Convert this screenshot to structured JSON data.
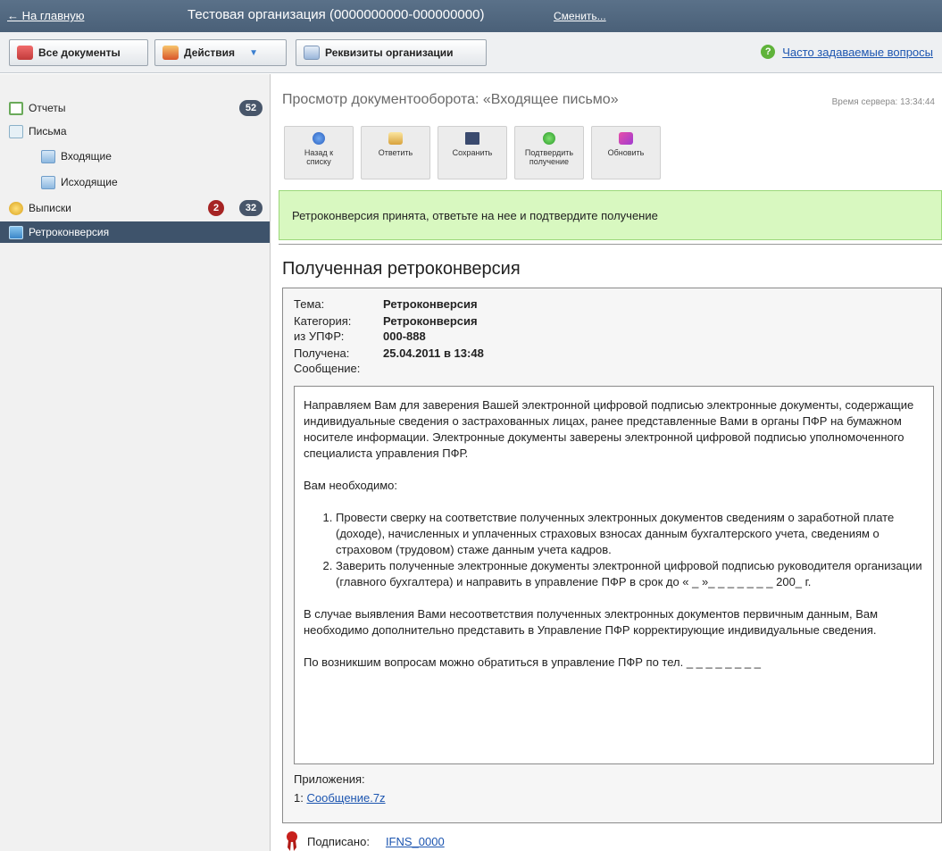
{
  "topbar": {
    "home_link": "← На главную",
    "org_name": "Тестовая организация (0000000000-000000000)",
    "change_link": "Сменить..."
  },
  "toolbar": {
    "all_docs": "Все документы",
    "actions": "Действия",
    "org_details": "Реквизиты организации",
    "faq": "Часто задаваемые вопросы"
  },
  "sidebar": {
    "reports": {
      "label": "Отчеты",
      "count": "52"
    },
    "letters": {
      "label": "Письма"
    },
    "incoming": {
      "label": "Входящие"
    },
    "outgoing": {
      "label": "Исходящие"
    },
    "statements": {
      "label": "Выписки",
      "count_red": "2",
      "count": "32"
    },
    "retro": {
      "label": "Ретроконверсия"
    }
  },
  "content": {
    "title": "Просмотр документооборота: «Входящее письмо»",
    "server_time": "Время сервера: 13:34:44",
    "actions": {
      "back": "Назад к списку",
      "reply": "Ответить",
      "save": "Сохранить",
      "confirm": "Подтвердить получение",
      "refresh": "Обновить"
    },
    "notice": "Ретроконверсия принята, ответьте на нее и подтвердите получение",
    "heading": "Полученная ретроконверсия",
    "meta": {
      "topic_k": "Тема:",
      "topic_v": "Ретроконверсия",
      "category_k": "Категория:",
      "category_v": "Ретроконверсия",
      "from_k": "из УПФР:",
      "from_v": "000-888",
      "received_k": "Получена:",
      "received_v": "25.04.2011 в 13:48",
      "message_k": "Сообщение:"
    },
    "message": {
      "p1": "Направляем Вам для заверения Вашей электронной цифровой подписью электронные документы, содержащие индивидуальные сведения о застрахованных лицах, ранее представленные Вами в органы ПФР на бумажном носителе информации. Электронные документы заверены электронной цифровой подписью уполномоченного специалиста управления ПФР.",
      "p2": "Вам необходимо:",
      "li1": "Провести сверку на соответствие полученных электронных документов сведениям о заработной плате (доходе), начисленных и уплаченных страховых взносах данным бухгалтерского учета, сведениям о страховом (трудовом) стаже данным учета кадров.",
      "li2": "Заверить полученные электронные документы электронной цифровой подписью руководителя организации (главного бухгалтера) и направить в управление ПФР в срок до « _ »_ _ _ _ _ _ _ 200_ г.",
      "p3": "В случае выявления Вами несоответствия полученных электронных документов первичным данным, Вам необходимо дополнительно представить в Управление ПФР корректирующие индивидуальные сведения.",
      "p4": "По возникшим вопросам можно обратиться в управление ПФР по тел. _ _ _ _ _ _ _ _"
    },
    "attachments_label": "Приложения:",
    "attachment_index": "1:",
    "attachment_name": "Сообщение.7z",
    "signed_label": "Подписано:",
    "signed_by": "IFNS_0000"
  }
}
